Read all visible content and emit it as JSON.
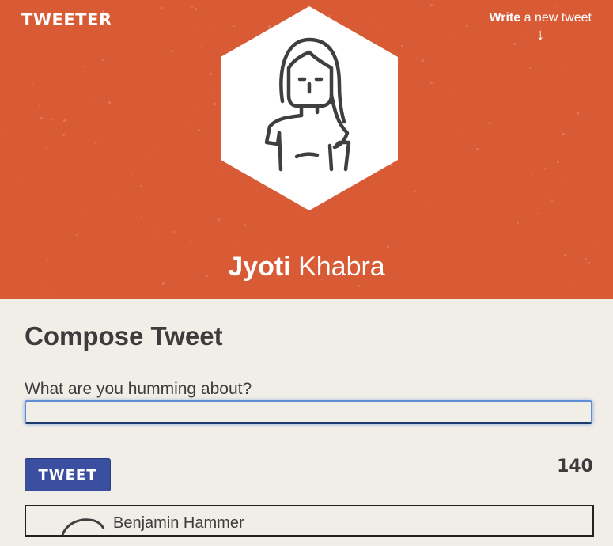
{
  "header": {
    "logo": "TWEETER",
    "write_link": {
      "strong": "Write",
      "rest": " a new tweet",
      "arrow": "↓"
    },
    "profile": {
      "first_name": "Jyoti",
      "last_name": "Khabra",
      "avatar_icon": "woman-avatar-icon"
    },
    "background_color": "#d95b35"
  },
  "compose": {
    "title": "Compose Tweet",
    "prompt": "What are you humming about?",
    "input_value": "",
    "button_label": "TWEET",
    "char_count": "140"
  },
  "tweets": [
    {
      "author": "Benjamin Hammer",
      "avatar_icon": "hedgehog-avatar-icon"
    }
  ],
  "colors": {
    "accent": "#d95b35",
    "button": "#3b4fa1",
    "page_bg": "#f1ede7"
  }
}
